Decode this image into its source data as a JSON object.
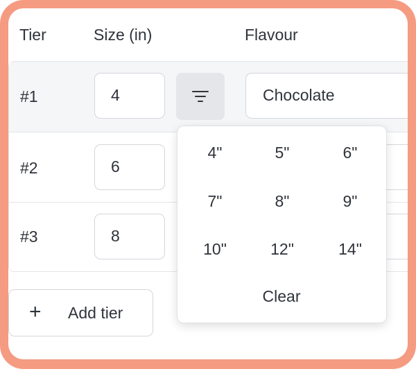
{
  "columns": {
    "tier": "Tier",
    "size": "Size (in)",
    "flavour": "Flavour"
  },
  "tiers": [
    {
      "id": "#1",
      "size": "4",
      "flavour": "Chocolate"
    },
    {
      "id": "#2",
      "size": "6",
      "flavour": ""
    },
    {
      "id": "#3",
      "size": "8",
      "flavour": ""
    }
  ],
  "size_picker": {
    "icon": "filter-lines-icon",
    "options": [
      "4\"",
      "5\"",
      "6\"",
      "7\"",
      "8\"",
      "9\"",
      "10\"",
      "12\"",
      "14\""
    ],
    "clear_label": "Clear"
  },
  "add_tier": {
    "icon": "plus-icon",
    "label": "Add tier"
  },
  "colors": {
    "frame": "#f59b82",
    "active_row": "#f5f6f8",
    "filter_button": "#e4e6ea",
    "border": "#d3d6db"
  }
}
